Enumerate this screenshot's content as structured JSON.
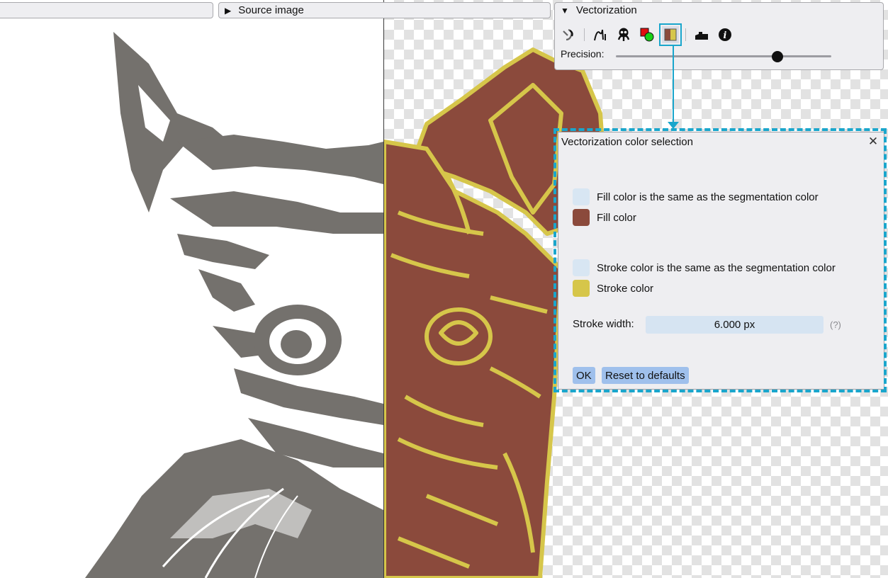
{
  "toolbar": {
    "source_label": "Source image"
  },
  "vectorization": {
    "title": "Vectorization",
    "tools": [
      "magic-wand-icon",
      "curve-icon",
      "octopus-icon",
      "shapes-color-icon",
      "color-selection-icon",
      "eraser-icon",
      "info-icon"
    ],
    "precision_label": "Precision:",
    "precision_value": 0.75
  },
  "dialog": {
    "title": "Vectorization color selection",
    "fill_same_label": "Fill color is the same as the segmentation color",
    "fill_label": "Fill color",
    "stroke_same_label": "Stroke color is the same as the segmentation color",
    "stroke_label": "Stroke color",
    "stroke_width_label": "Stroke width:",
    "stroke_width_value": "6.000 px",
    "help_label": "(?)",
    "ok_label": "OK",
    "reset_label": "Reset to defaults"
  },
  "colors": {
    "fill": "#8b4a3c",
    "stroke": "#d6c64a",
    "checkbox": "#d8e6f3",
    "accent": "#1aa6cc",
    "sketch": "#6d6a66"
  }
}
